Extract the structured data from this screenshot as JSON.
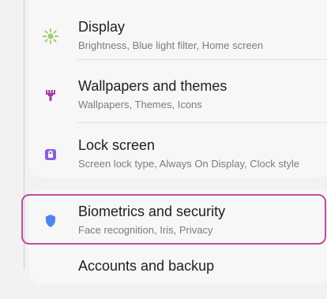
{
  "settings": {
    "items": [
      {
        "title": "Display",
        "subtitle": "Brightness, Blue light filter, Home screen",
        "icon": "sun-icon",
        "icon_color": "#9bd06b"
      },
      {
        "title": "Wallpapers and themes",
        "subtitle": "Wallpapers, Themes, Icons",
        "icon": "paintbrush-icon",
        "icon_color": "#a03b9f"
      },
      {
        "title": "Lock screen",
        "subtitle": "Screen lock type, Always On Display, Clock style",
        "icon": "lock-icon",
        "icon_color": "#8b5fd9"
      },
      {
        "title": "Biometrics and security",
        "subtitle": "Face recognition, Iris, Privacy",
        "icon": "shield-icon",
        "icon_color": "#4d86f0"
      },
      {
        "title": "Accounts and backup",
        "subtitle": "",
        "icon": "",
        "icon_color": ""
      }
    ],
    "highlight_color": "#c14b9f"
  }
}
